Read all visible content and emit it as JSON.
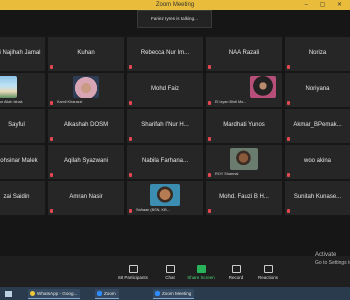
{
  "window": {
    "title": "Zoom Meeting",
    "controls": "– ▢ ✕"
  },
  "speaking_indicator": "Fariez Iyres is talking...",
  "participants": [
    {
      "name": "Siti Najihah Jamal"
    },
    {
      "name": "Kuhan"
    },
    {
      "name": "Rebecca Nur Im..."
    },
    {
      "name": "NAA Razali"
    },
    {
      "name": "Noriza"
    },
    {
      "name": "",
      "label": "Nur Aliah Ishak",
      "video": "beach"
    },
    {
      "name": "",
      "label": "Kamil Kharazzi",
      "video": "woman"
    },
    {
      "name": "Mohd Faiz"
    },
    {
      "name": "",
      "label": "El Izyan Binti Mo...",
      "video": "hijab"
    },
    {
      "name": "Noriyana"
    },
    {
      "name": "Sayful"
    },
    {
      "name": "Alkashah DOSM"
    },
    {
      "name": "Sharifah I'Nur H..."
    },
    {
      "name": "Mardhati Yunos"
    },
    {
      "name": "Akmar_BPemak..."
    },
    {
      "name": "Mohsinar Malek"
    },
    {
      "name": "Aqilah Syazwani"
    },
    {
      "name": "Nabila  Farhana..."
    },
    {
      "name": "",
      "label": "ROY Sharmal",
      "video": "man"
    },
    {
      "name": "woo akina"
    },
    {
      "name": "zai Saidin"
    },
    {
      "name": "Amran Nasir"
    },
    {
      "name": "",
      "label": "Safraan (BSN, KB...",
      "video": "selfie"
    },
    {
      "name": "Mohd. Fauzi B H..."
    },
    {
      "name": "Sunitah  Kunase..."
    }
  ],
  "toolbar": {
    "participants": "Participants",
    "participants_count": "68",
    "chat": "Chat",
    "share_screen": "Share Screen",
    "record": "Record",
    "reactions": "Reactions"
  },
  "activate_windows": {
    "title": "Activate",
    "subtitle": "Go to Settings to activ"
  },
  "taskbar": {
    "items": [
      "WhatsApp - Goog...",
      "Zoom",
      "Zoom Meeting"
    ]
  }
}
